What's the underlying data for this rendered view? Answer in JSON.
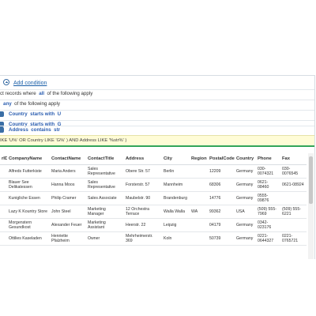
{
  "query": {
    "add_condition": "Add condition",
    "line1": {
      "prefix": "ct records where",
      "keyword": "all",
      "suffix": "of the following apply"
    },
    "line2": {
      "keyword": "any",
      "suffix": "of the following apply"
    },
    "conditions": [
      {
        "field": "Country",
        "op": "starts with",
        "value": "U"
      },
      {
        "field": "Country",
        "op": "starts with",
        "value": "G"
      },
      {
        "field": "Address",
        "op": "contains",
        "value": "str"
      }
    ],
    "sql": "IKE 'U%' OR  Country LIKE 'G%' ) AND  Address LIKE '%str%' )"
  },
  "grid": {
    "columns": [
      "rID",
      "CompanyName",
      "ContactName",
      "ContactTitle",
      "Address",
      "City",
      "Region",
      "PostalCode",
      "Country",
      "Phone",
      "Fax"
    ],
    "rows": [
      [
        "",
        "Alfreds Futterkiste",
        "Maria Anders",
        "Sales Representative",
        "Obere Str. 57",
        "Berlin",
        "",
        "12209",
        "Germany",
        "030-0074321",
        "030-0076545"
      ],
      [
        "",
        "Blauer See Delikatessen",
        "Hanna Moos",
        "Sales Representative",
        "Forsterstr. 57",
        "Mannheim",
        "",
        "68306",
        "Germany",
        "0621-08460",
        "0621-08924"
      ],
      [
        "",
        "Kunigliche Essen",
        "Philip Cramer",
        "Sales Associate",
        "Maubelstr. 90",
        "Brandenburg",
        "",
        "14776",
        "Germany",
        "0555-09876",
        ""
      ],
      [
        "",
        "Lazy K Kountry Store",
        "John Steel",
        "Marketing Manager",
        "12 Orchestra Terrace",
        "Walla Walla",
        "WA",
        "99362",
        "USA",
        "(509) 555-7969",
        "(509) 555-6221"
      ],
      [
        "",
        "Morgenstern Gesundkost",
        "Alexander Feuer",
        "Marketing Assistant",
        "Heerstr. 22",
        "Leipzig",
        "",
        "04179",
        "Germany",
        "0342-023176",
        ""
      ],
      [
        "",
        "Ottilies Kaseladen",
        "Henriette Pfalzheim",
        "Owner",
        "Mehrheimerstr. 369",
        "Koln",
        "",
        "50739",
        "Germany",
        "0221-0644327",
        "0221-0765721"
      ]
    ]
  }
}
